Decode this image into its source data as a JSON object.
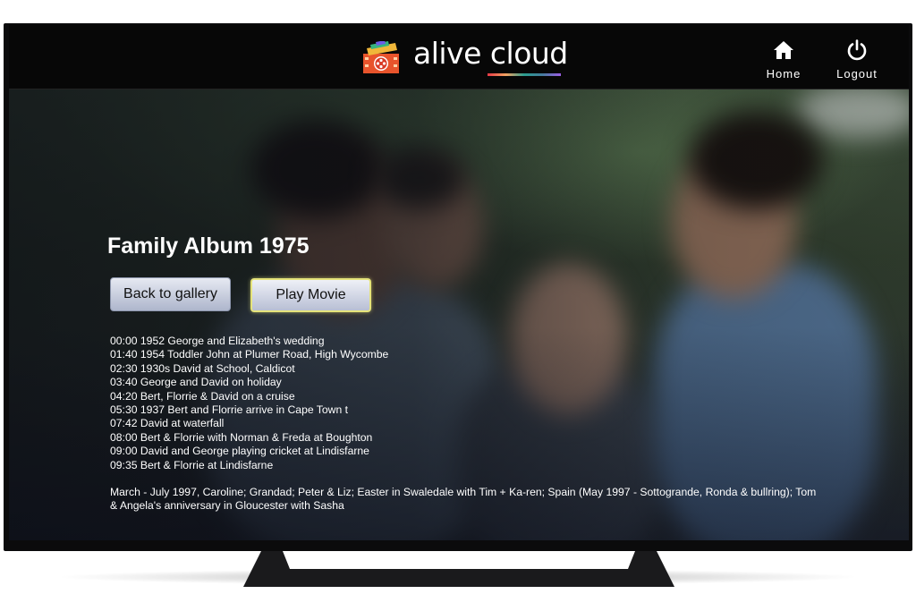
{
  "header": {
    "brand": "alive cloud",
    "nav": [
      {
        "label": "Home",
        "icon": "home-icon"
      },
      {
        "label": "Logout",
        "icon": "power-icon"
      }
    ]
  },
  "content": {
    "title": "Family Album 1975",
    "buttons": {
      "back": "Back to gallery",
      "play": "Play Movie"
    },
    "chapters": [
      "00:00 1952 George and Elizabeth's wedding",
      "01:40 1954 Toddler John at Plumer Road, High Wycombe",
      "02:30 1930s David at School, Caldicot",
      "03:40 George and David on holiday",
      "04:20 Bert, Florrie & David on a cruise",
      "05:30 1937 Bert and Florrie arrive in Cape Town t",
      "07:42 David at waterfall",
      "08:00 Bert & Florrie with Norman & Freda at Boughton",
      "09:00 David and George playing cricket at Lindisfarne",
      "09:35 Bert & Florrie at Lindisfarne"
    ],
    "notes": "March - July 1997, Caroline; Grandad; Peter & Liz; Easter in Swaledale with Tim + Ka-ren; Spain (May 1997 - Sottogrande, Ronda & bullring); Tom & Angela's anniversary in Gloucester with Sasha"
  },
  "colors": {
    "header_bg": "#070707",
    "focus_border": "#e5e37a",
    "text": "#ffffff"
  }
}
